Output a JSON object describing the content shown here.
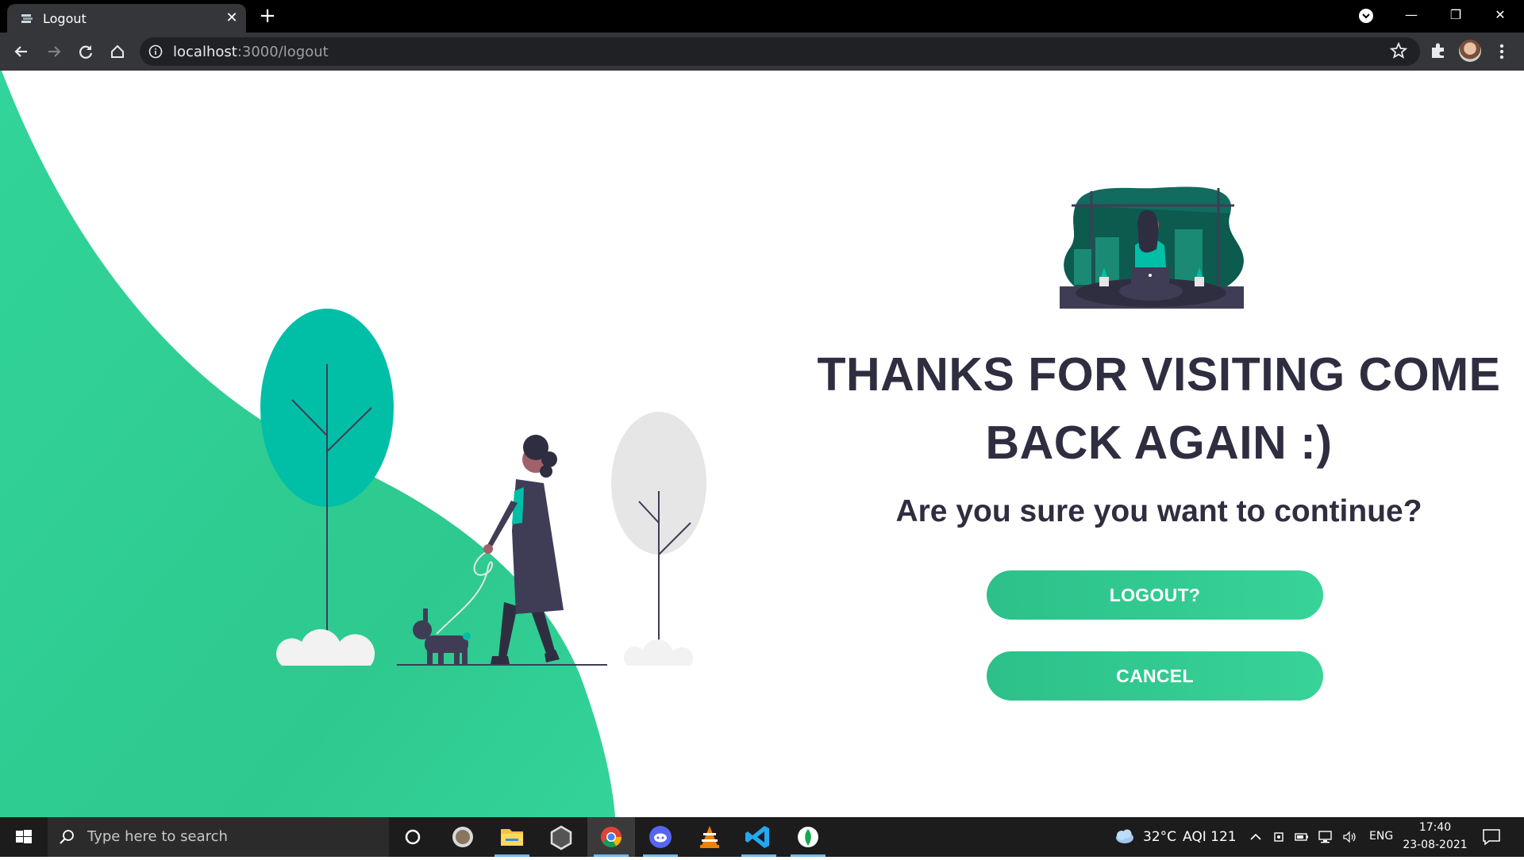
{
  "browser": {
    "tab_title": "Logout",
    "url_host": "localhost",
    "url_rest": ":3000/logout"
  },
  "page": {
    "headline_line1": "THANKS FOR VISITING COME",
    "headline_line2": "BACK AGAIN :)",
    "question": "Are you sure you want to continue?",
    "logout_label": "LOGOUT?",
    "cancel_label": "CANCEL",
    "colors": {
      "accent": "#2fcf95",
      "accent_dark": "#00bfa6",
      "text": "#2f2e41",
      "tree_gray": "#e6e6e6"
    }
  },
  "taskbar": {
    "search_placeholder": "Type here to search",
    "apps": [
      "cortana-icon",
      "app-icon",
      "file-explorer-icon",
      "unity-icon",
      "chrome-icon",
      "discord-icon",
      "vlc-icon",
      "vscode-icon",
      "mongodb-icon"
    ],
    "temperature": "32°C",
    "aqi": "AQI 121",
    "language": "ENG",
    "time": "17:40",
    "date": "23-08-2021"
  }
}
